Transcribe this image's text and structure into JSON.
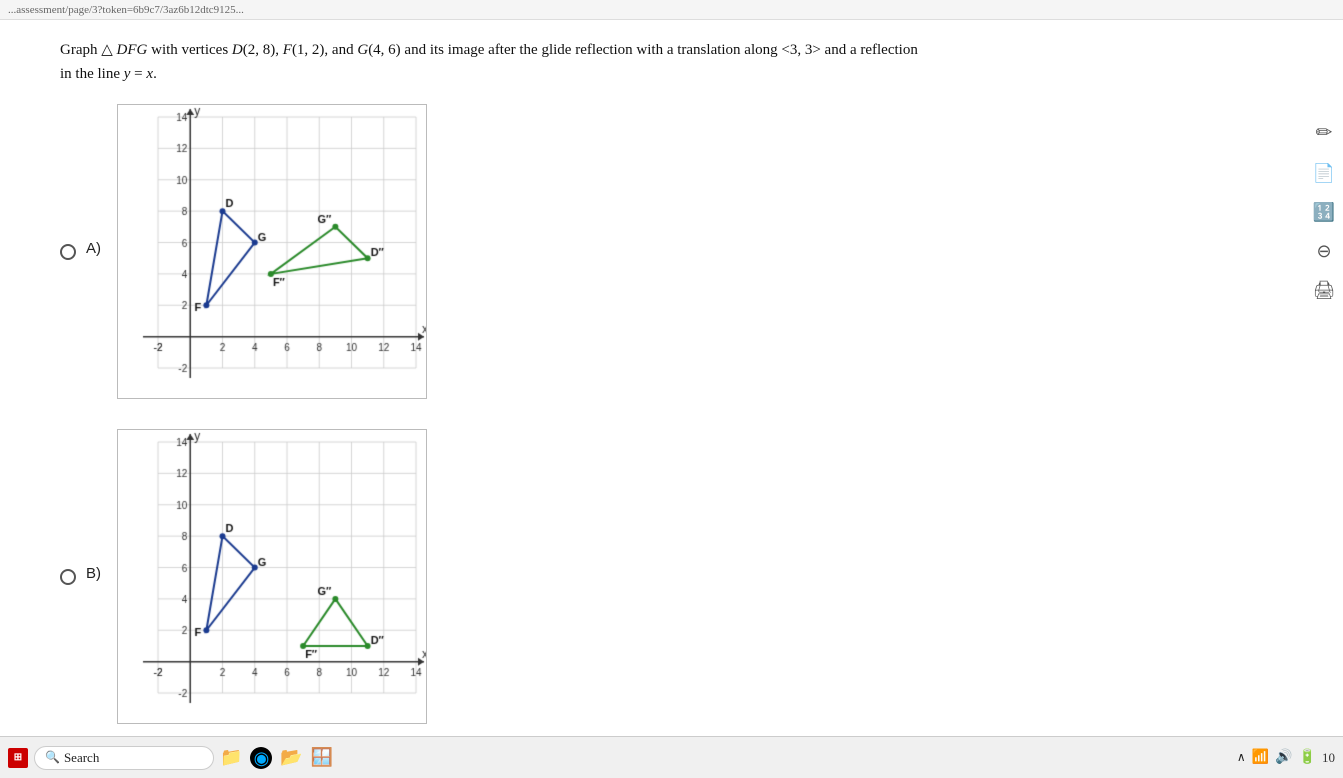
{
  "problem": {
    "text_part1": "Graph ",
    "triangle_symbol": "△",
    "text_part2": " DFG with vertices D(2, 8), F(1, 2), and G(4, 6) and its image after the glide reflection with a translation along <3, 3> and a reflection",
    "text_part3": "in the line ",
    "text_equation": "y = x.",
    "full_line1": "Graph △ DFG with vertices D(2, 8), F(1, 2), and G(4, 6) and its image after the glide reflection with a translation along <3, 3> and a reflection",
    "full_line2": "in the line y = x."
  },
  "options": [
    {
      "id": "A",
      "label": "A)",
      "selected": false
    },
    {
      "id": "B",
      "label": "B)",
      "selected": false
    }
  ],
  "taskbar": {
    "search_placeholder": "Search",
    "page_number": "10"
  },
  "sidebar": {
    "icons": [
      "✏️",
      "📋",
      "🔢",
      "⊖",
      "🖨"
    ]
  }
}
